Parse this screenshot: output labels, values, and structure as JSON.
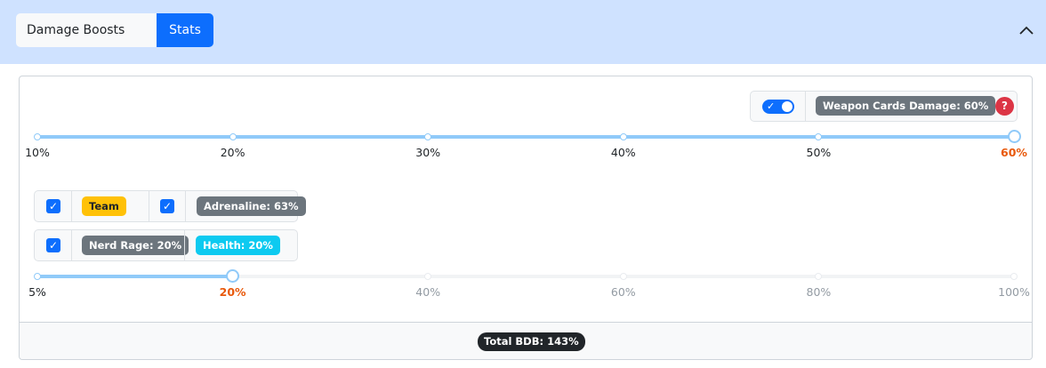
{
  "header": {
    "tabs": [
      {
        "label": "Damage Boosts",
        "active": false
      },
      {
        "label": "Stats",
        "active": true
      }
    ],
    "collapse_icon": "chevron-up-icon"
  },
  "weapon_cards": {
    "toggle_on": true,
    "label": "Weapon Cards Damage: 60%",
    "help_label": "?"
  },
  "weapon_slider": {
    "ticks": [
      "10%",
      "20%",
      "30%",
      "40%",
      "50%",
      "60%"
    ],
    "selected": "60%"
  },
  "boost_groups": {
    "row1": {
      "team_checked": true,
      "team_label": "Team",
      "adrenaline_checked": true,
      "adrenaline_label": "Adrenaline: 63%"
    },
    "row2": {
      "nerd_rage_checked": true,
      "nerd_rage_label": "Nerd Rage: 20%",
      "health_label": "Health: 20%"
    }
  },
  "health_slider": {
    "ticks": [
      "5%",
      "20%",
      "40%",
      "60%",
      "80%",
      "100%"
    ],
    "selected": "20%"
  },
  "footer": {
    "total_label": "Total BDB: 143%"
  },
  "colors": {
    "header_bg": "#cfe2ff",
    "primary": "#0d6efd",
    "slider_fill": "#90caf9",
    "selected_tick": "#e8590c",
    "badge_secondary": "#6c757d",
    "badge_warning": "#ffc107",
    "badge_info": "#0dcaf0",
    "help_red": "#dc3545"
  }
}
